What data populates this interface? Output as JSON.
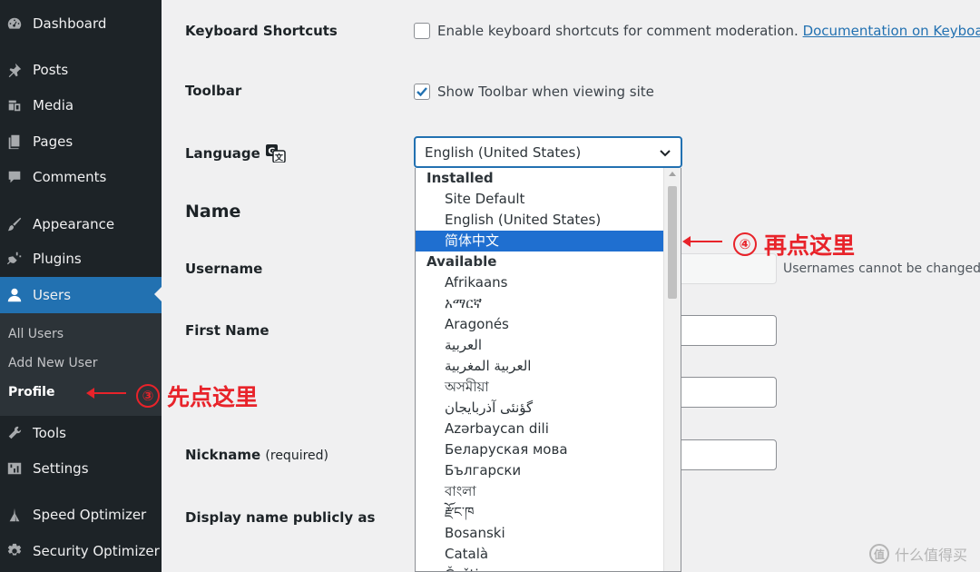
{
  "sidebar": {
    "items": [
      {
        "label": "Dashboard",
        "icon": "dashboard-icon"
      },
      {
        "label": "Posts",
        "icon": "pin-icon"
      },
      {
        "label": "Media",
        "icon": "media-icon"
      },
      {
        "label": "Pages",
        "icon": "pages-icon"
      },
      {
        "label": "Comments",
        "icon": "comment-icon"
      },
      {
        "label": "Appearance",
        "icon": "brush-icon"
      },
      {
        "label": "Plugins",
        "icon": "plug-icon"
      },
      {
        "label": "Users",
        "icon": "user-icon"
      },
      {
        "label": "Tools",
        "icon": "wrench-icon"
      },
      {
        "label": "Settings",
        "icon": "sliders-icon"
      },
      {
        "label": "Speed Optimizer",
        "icon": "speed-icon"
      },
      {
        "label": "Security Optimizer",
        "icon": "gear-lock-icon"
      }
    ],
    "active": "Users",
    "submenu": [
      "All Users",
      "Add New User",
      "Profile"
    ],
    "current_sub": "Profile"
  },
  "form": {
    "keyboard_shortcuts": {
      "label": "Keyboard Shortcuts",
      "checkbox_text": "Enable keyboard shortcuts for comment moderation.",
      "link_text": "Documentation on Keyboard Sh",
      "checked": false
    },
    "toolbar": {
      "label": "Toolbar",
      "checkbox_text": "Show Toolbar when viewing site",
      "checked": true
    },
    "language": {
      "label": "Language",
      "icon": "translate-icon",
      "selected": "English (United States)"
    },
    "name_section": "Name",
    "username": {
      "label": "Username",
      "note": "Usernames cannot be changed."
    },
    "first_name": {
      "label": "First Name"
    },
    "nickname": {
      "label": "Nickname",
      "required_note": "(required)"
    },
    "display_name": {
      "label": "Display name publicly as"
    }
  },
  "dropdown": {
    "groups": [
      {
        "label": "Installed",
        "options": [
          "Site Default",
          "English (United States)",
          "简体中文"
        ]
      },
      {
        "label": "Available",
        "options": [
          "Afrikaans",
          "አማርኛ",
          "Aragonés",
          "العربية",
          "العربية المغربية",
          "অসমীয়া",
          "گؤنئی آذربایجان",
          "Azərbaycan dili",
          "Беларуская мова",
          "Български",
          "বাংলা",
          "རྫོང་ཁ",
          "Bosanski",
          "Català",
          "Čeština"
        ]
      }
    ],
    "highlighted": "简体中文",
    "scroll_position": 0.0
  },
  "annotations": {
    "step3_num": "③",
    "step3_text": "先点这里",
    "step4_num": "④",
    "step4_text": "再点这里",
    "color": "#e8232a"
  },
  "watermark": {
    "logo": "值",
    "text": "什么值得买"
  },
  "colors": {
    "sidebar_bg": "#1d2327",
    "accent": "#2271b1",
    "highlight": "#1f6fd0"
  }
}
